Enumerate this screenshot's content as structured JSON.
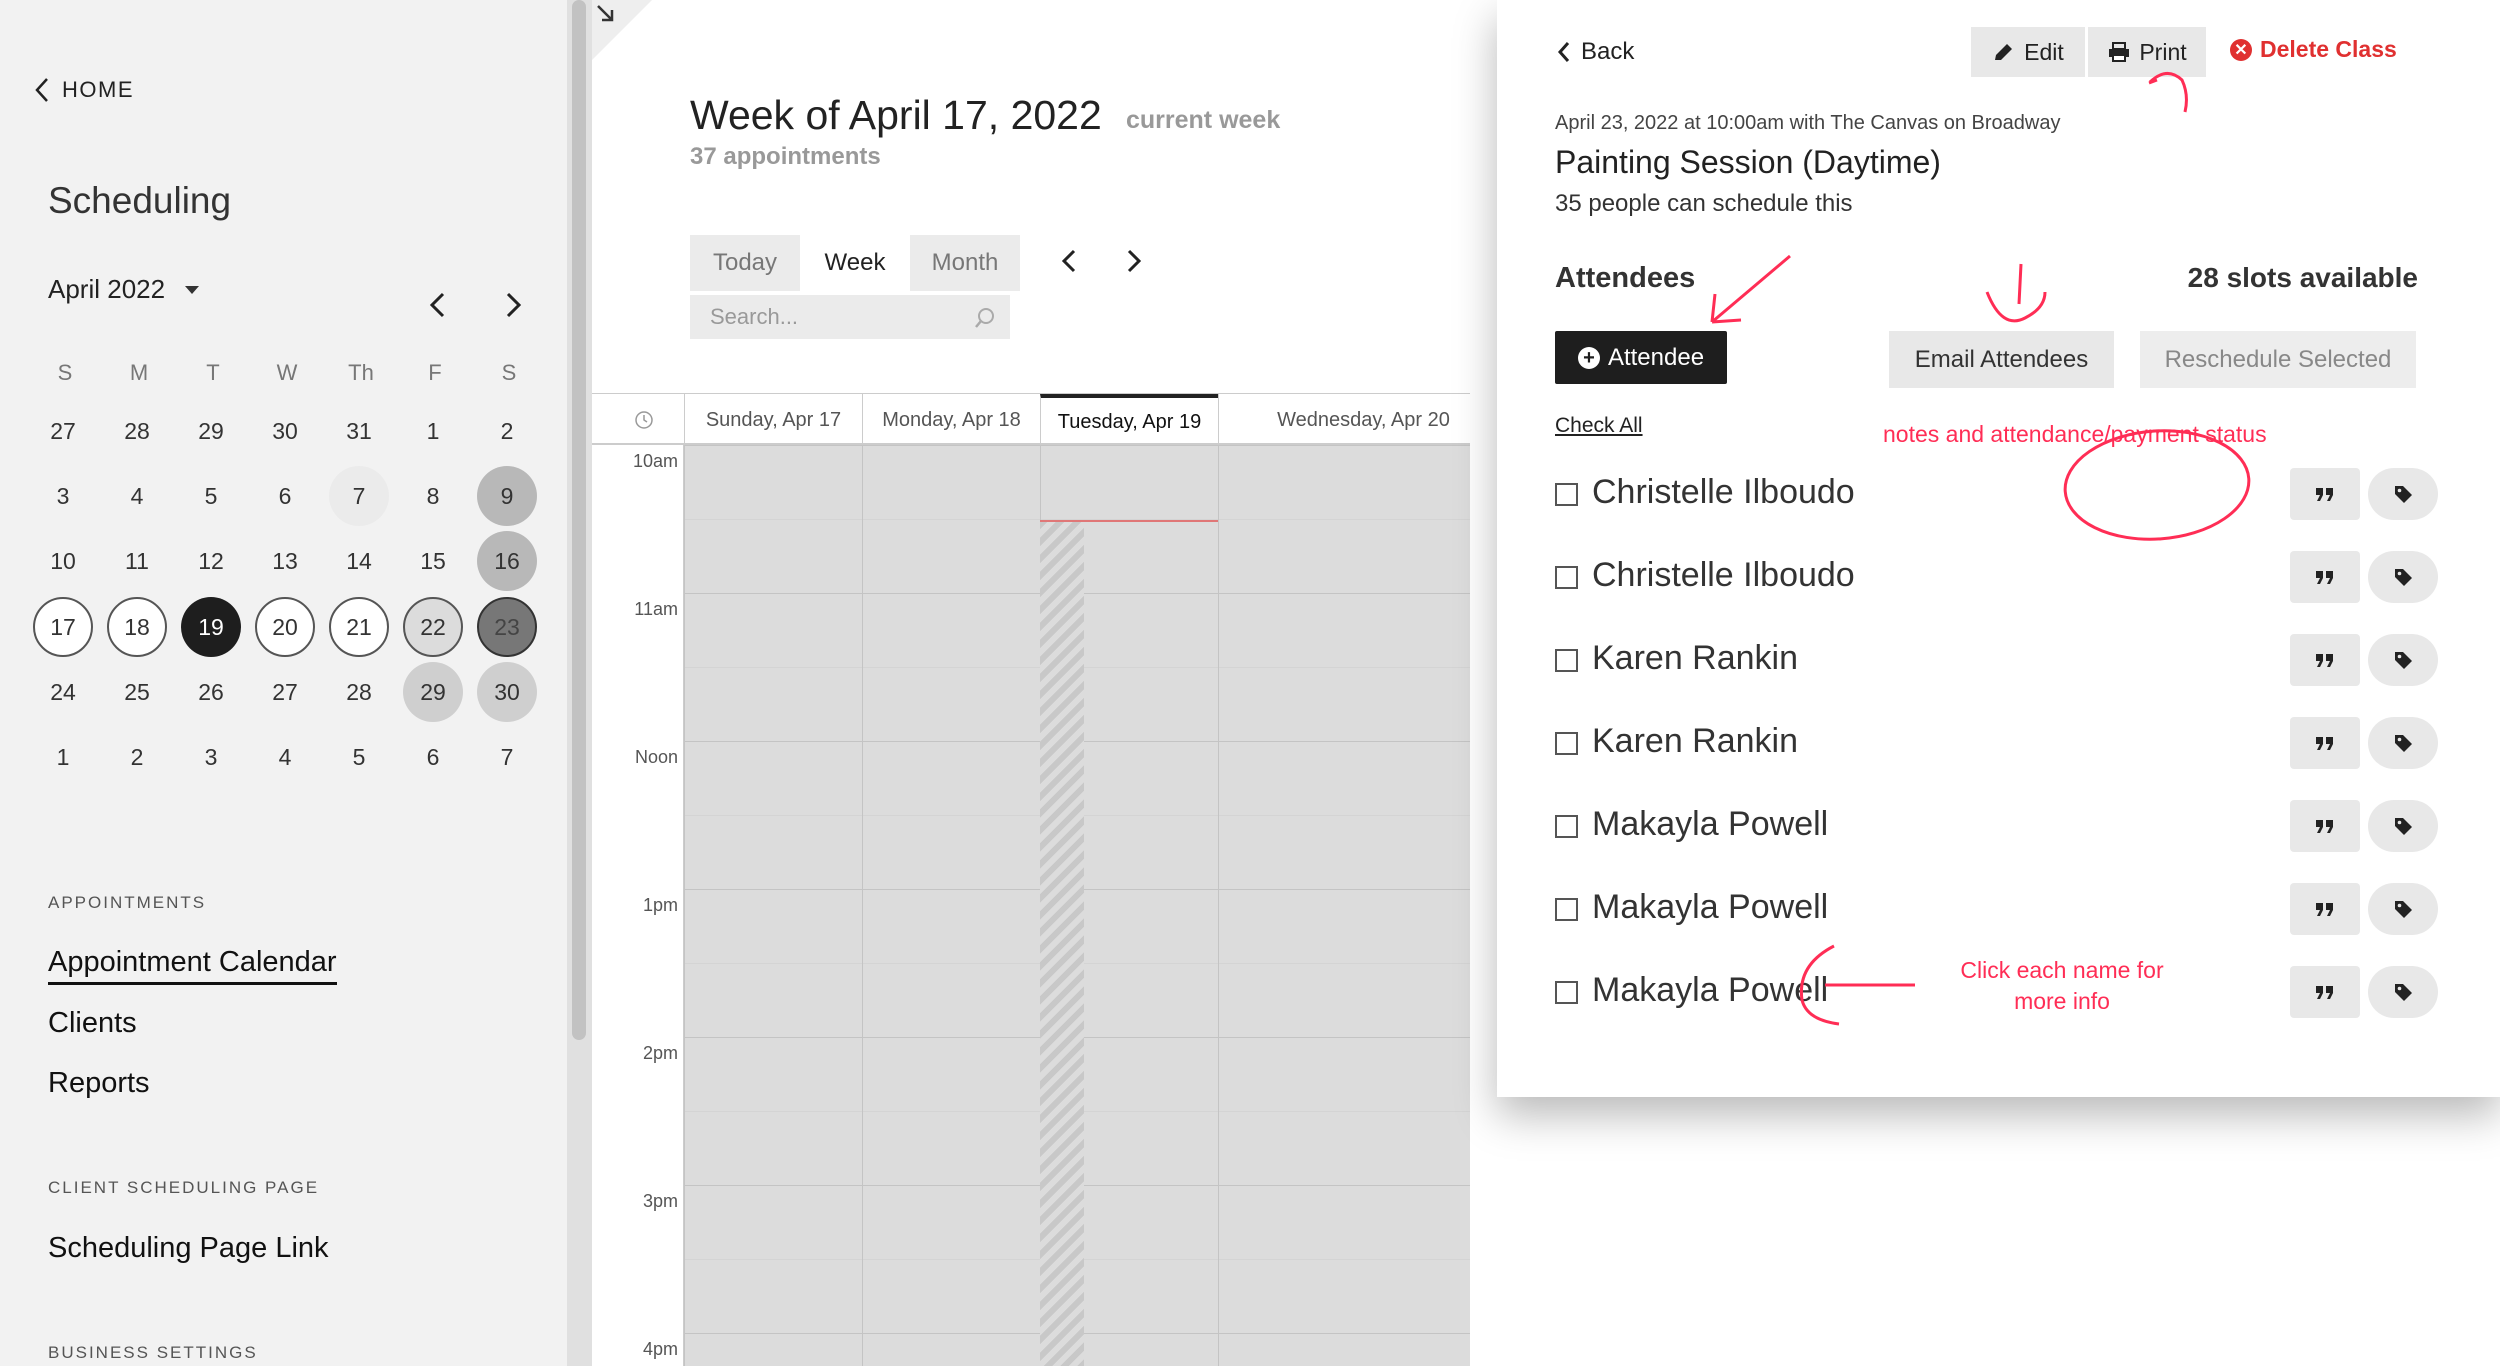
{
  "sidebar": {
    "home_label": "HOME",
    "title": "Scheduling",
    "month_label": "April 2022",
    "weekdays": [
      "S",
      "M",
      "T",
      "W",
      "Th",
      "F",
      "S"
    ],
    "weeks": [
      [
        "27",
        "28",
        "29",
        "30",
        "31",
        "1",
        "2"
      ],
      [
        "3",
        "4",
        "5",
        "6",
        "7",
        "8",
        "9"
      ],
      [
        "10",
        "11",
        "12",
        "13",
        "14",
        "15",
        "16"
      ],
      [
        "17",
        "18",
        "19",
        "20",
        "21",
        "22",
        "23"
      ],
      [
        "24",
        "25",
        "26",
        "27",
        "28",
        "29",
        "30"
      ],
      [
        "1",
        "2",
        "3",
        "4",
        "5",
        "6",
        "7"
      ]
    ],
    "appointments_section": "APPOINTMENTS",
    "nav_calendar": "Appointment Calendar",
    "nav_clients": "Clients",
    "nav_reports": "Reports",
    "client_section": "CLIENT SCHEDULING PAGE",
    "nav_link": "Scheduling Page Link",
    "business_section": "BUSINESS SETTINGS"
  },
  "main": {
    "week_title": "Week of April 17, 2022",
    "current_week": "current week",
    "appointment_count": "37 appointments",
    "tabs": [
      {
        "label": "Today"
      },
      {
        "label": "Week"
      },
      {
        "label": "Month"
      }
    ],
    "search_placeholder": "Search...",
    "columns": [
      "Sunday, Apr 17",
      "Monday, Apr 18",
      "Tuesday, Apr 19",
      "Wednesday, Apr 20"
    ],
    "times": [
      "10am",
      "11am",
      "Noon",
      "1pm",
      "2pm",
      "3pm",
      "4pm"
    ]
  },
  "panel": {
    "back_label": "Back",
    "edit_label": "Edit",
    "print_label": "Print",
    "delete_label": "Delete Class",
    "meta": "April 23, 2022 at 10:00am with The Canvas on Broadway",
    "title": "Painting Session (Daytime)",
    "capacity": "35 people can schedule this",
    "attendees_heading": "Attendees",
    "slots": "28 slots available",
    "add_attendee_label": "Attendee",
    "email_label": "Email Attendees",
    "reschedule_label": "Reschedule Selected",
    "check_all": "Check All",
    "attendees": [
      {
        "name": "Christelle Ilboudo"
      },
      {
        "name": "Christelle Ilboudo"
      },
      {
        "name": "Karen Rankin"
      },
      {
        "name": "Karen Rankin"
      },
      {
        "name": "Makayla Powell"
      },
      {
        "name": "Makayla Powell"
      },
      {
        "name": "Makayla Powell"
      }
    ]
  },
  "annotations": {
    "notes_status": "notes and attendance/payment status",
    "click_name_line1": "Click each name for",
    "click_name_line2": "more info"
  },
  "colors": {
    "accent_annotation": "#ff2d55",
    "delete": "#e03030",
    "dark_button": "#1e1e1e"
  },
  "icons": [
    "chevron-left-icon",
    "chevron-right-icon",
    "caret-down-icon",
    "search-icon",
    "pencil-icon",
    "printer-icon",
    "close-circle-icon",
    "plus-circle-icon",
    "quote-icon",
    "tag-icon",
    "clock-icon",
    "collapse-arrow-icon"
  ]
}
